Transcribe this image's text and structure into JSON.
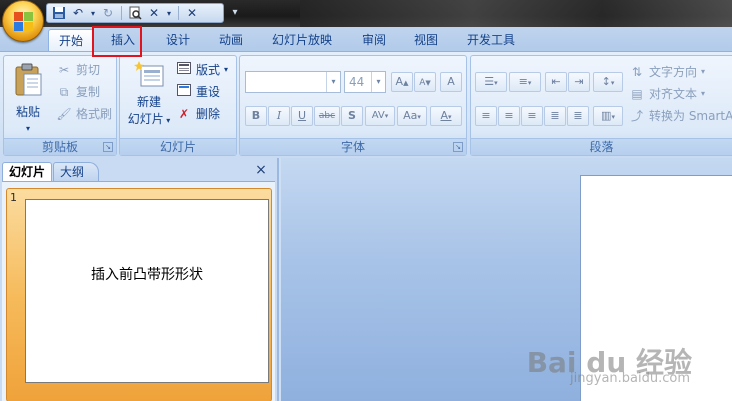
{
  "qat": {
    "icons": [
      "save-icon",
      "undo-icon",
      "redo-icon",
      "print-preview-icon",
      "spell-icon",
      "close-icon",
      "customize-icon"
    ]
  },
  "tabs": [
    "开始",
    "插入",
    "设计",
    "动画",
    "幻灯片放映",
    "审阅",
    "视图",
    "开发工具"
  ],
  "groups": {
    "clipboard": {
      "title": "剪贴板",
      "paste": "粘贴",
      "cut": "剪切",
      "copy": "复制",
      "format_painter": "格式刷"
    },
    "slides": {
      "title": "幻灯片",
      "new_slide_line1": "新建",
      "new_slide_line2": "幻灯片",
      "layout": "版式",
      "reset": "重设",
      "delete": "删除"
    },
    "font": {
      "title": "字体",
      "font_name": "",
      "font_size": "44",
      "bold": "B",
      "italic": "I",
      "underline": "U",
      "strike": "abc",
      "shadow": "S",
      "spacing": "AV",
      "case": "Aa",
      "grow": "A",
      "shrink": "A",
      "clear": "A",
      "color": "A"
    },
    "paragraph": {
      "title": "段落",
      "text_direction": "文字方向",
      "align_text": "对齐文本",
      "convert_smartart": "转换为 SmartArt"
    }
  },
  "left_panel": {
    "tab_slides": "幻灯片",
    "tab_outline": "大纲",
    "close": "×",
    "slide_number": "1",
    "slide_text": "插入前凸带形形状"
  },
  "watermark": {
    "main": "Bai du 经验",
    "sub": "jingyan.baidu.com"
  },
  "colors": {
    "highlight_box": "#e1141e",
    "ribbon_text": "#15428b"
  }
}
